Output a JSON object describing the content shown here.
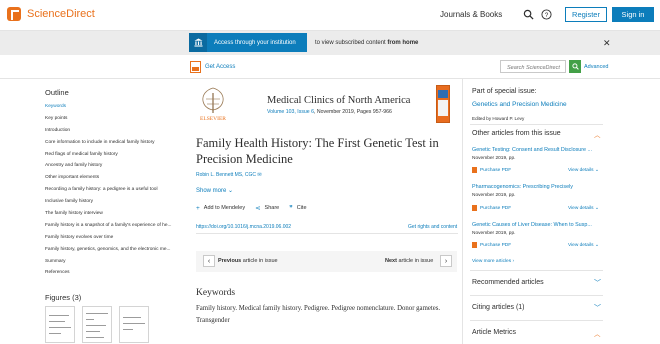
{
  "header": {
    "logo_text": "ScienceDirect",
    "journals_books": "Journals & Books",
    "register_label": "Register",
    "signin_label": "Sign in"
  },
  "banner": {
    "access_button": "Access through your institution",
    "text_prefix": "to view subscribed content ",
    "text_bold": "from home"
  },
  "toolbar": {
    "get_access": "Get Access",
    "search_placeholder": "Search ScienceDirect",
    "advanced": "Advanced"
  },
  "outline": {
    "title": "Outline",
    "items": [
      "Keywords",
      "Key points",
      "Introduction",
      "Core information to include in medical family history",
      "Red flags of medical family history",
      "Ancestry and family history",
      "Other important elements",
      "Recording a family history: a pedigree is a useful tool",
      "Inclusive family history",
      "The family history interview",
      "Family history is a snapshot of a family's experience of he...",
      "Family history evolves over time",
      "Family history, genetics, genomics, and the electronic me...",
      "Summary",
      "References"
    ]
  },
  "figures": {
    "title": "Figures (3)"
  },
  "article": {
    "journal": "Medical Clinics of North America",
    "volume_link": "Volume 103, Issue 6",
    "meta_rest": ", November 2019, Pages 957-966",
    "title": "Family Health History: The First Genetic Test in Precision Medicine",
    "authors": "Robin L. Bennett MS, CGC",
    "show_more": "Show more",
    "add_to_mendeley": "Add to Mendeley",
    "share": "Share",
    "cite": "Cite",
    "doi": "https://doi.org/10.1016/j.mcna.2019.06.002",
    "rights": "Get rights and content",
    "prev_bold": "Previous",
    "prev_rest": " article in issue",
    "next_bold": "Next",
    "next_rest": " article in issue",
    "keywords_title": "Keywords",
    "keywords": "Family history. Medical family history. Pedigree. Pedigree nomenclature. Donor gametes. Transgender"
  },
  "sidebar": {
    "special_issue_label": "Part of special issue:",
    "special_issue_title": "Genetics and Precision Medicine",
    "edited_by": "Edited by Howard P. Levy",
    "other_articles_title": "Other articles from this issue",
    "articles": [
      {
        "title": "Genetic Testing: Consent and Result Disclosure ...",
        "date": "November 2019, pp.",
        "pdf": "Purchase PDF",
        "details": "View details"
      },
      {
        "title": "Pharmacogenomics: Prescribing Precisely",
        "date": "November 2019, pp.",
        "pdf": "Purchase PDF",
        "details": "View details"
      },
      {
        "title": "Genetic Causes of Liver Disease: When to Susp...",
        "date": "November 2019, pp.",
        "pdf": "Purchase PDF",
        "details": "View details"
      }
    ],
    "view_more": "View more articles",
    "recommended": "Recommended articles",
    "citing": "Citing articles (1)",
    "metrics": "Article Metrics"
  },
  "colors": {
    "brand_orange": "#e9711c",
    "link_blue": "#0c7dbb",
    "search_green": "#43a047"
  }
}
